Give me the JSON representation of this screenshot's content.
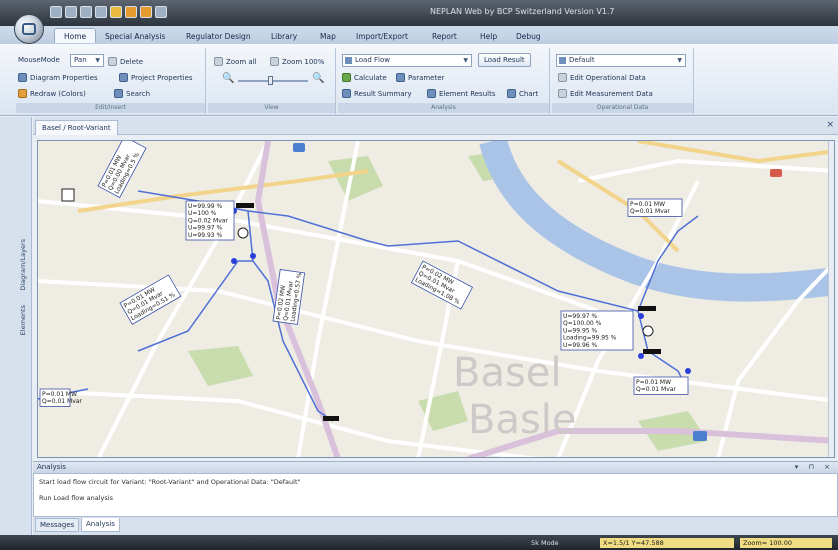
{
  "app": {
    "title": "NEPLAN Web by BCP Switzerland Version V1.7"
  },
  "ribbon_tabs": [
    "Home",
    "Special Analysis",
    "Regulator Design",
    "Library",
    "Map",
    "Import/Export",
    "Report",
    "Help",
    "Debug"
  ],
  "ribbon": {
    "edit": {
      "mousemode_label": "MouseMode",
      "mousemode_value": "Pan",
      "delete_label": "Delete",
      "diagram_props_label": "Diagram Properties",
      "project_props_label": "Project Properties",
      "redraw_label": "Redraw (Colors)",
      "search_label": "Search",
      "group_label": "Edit/Insert"
    },
    "view": {
      "zoom_all_label": "Zoom all",
      "zoom_100_label": "Zoom 100%",
      "group_label": "View"
    },
    "analysis": {
      "analysis_value": "Load Flow",
      "load_result_label": "Load Result",
      "calculate_label": "Calculate",
      "parameter_label": "Parameter",
      "result_summary_label": "Result Summary",
      "element_results_label": "Element Results",
      "chart_label": "Chart",
      "group_label": "Analysis"
    },
    "operational": {
      "default_value": "Default",
      "edit_operational_label": "Edit Operational Data",
      "edit_measurement_label": "Edit Measurement Data",
      "group_label": "Operational Data"
    }
  },
  "left_tabs": [
    "Elements",
    "Diagram/Layers"
  ],
  "document_tab": "Basel / Root-Variant",
  "map": {
    "city_label": "Basel",
    "city_label_sub": "Basle",
    "boxes": [
      {
        "lines": [
          "P=0.01 MW",
          "Q=0.00 Mvar",
          "Loading=0.5 %"
        ]
      },
      {
        "lines": [
          "U=99.99 %",
          "U=100 %",
          "Q=0.02 Mvar",
          "U=99.97 %",
          "U=99.93 %"
        ]
      },
      {
        "lines": [
          "P=0.01 MW",
          "Q=0.01 Mvar",
          "Loading=0.51 %"
        ]
      },
      {
        "lines": [
          "P=0.02 MW",
          "Q=0.01 Mvar",
          "Loading=1.08 %"
        ]
      },
      {
        "lines": [
          "P=0.02 MW",
          "Q=0.01 Mvar",
          "Loading=0.57 %"
        ]
      },
      {
        "lines": [
          "P=0.01 MW",
          "Q=0.01 Mvar"
        ]
      },
      {
        "lines": [
          "U=99.97 %",
          "Q=100.00 %",
          "U=99.95 %",
          "Loading=99.95 %",
          "U=99.96 %"
        ]
      },
      {
        "lines": [
          "P=0.01 MW",
          "Q=0.01 Mvar"
        ]
      },
      {
        "lines": [
          "P=0.01 MW",
          "Q=0.01 Mvar"
        ]
      }
    ]
  },
  "panel": {
    "title": "Analysis",
    "log": [
      "Start load flow circuit for Variant: \"Root-Variant\" and Operational Data: \"Default\"",
      "Run Load flow analysis"
    ],
    "tabs": [
      "Messages",
      "Analysis"
    ]
  },
  "status": {
    "mode": "5k Mode",
    "coords": "X=1.5/1 Y=47.588",
    "zoom": "Zoom= 100.00"
  }
}
